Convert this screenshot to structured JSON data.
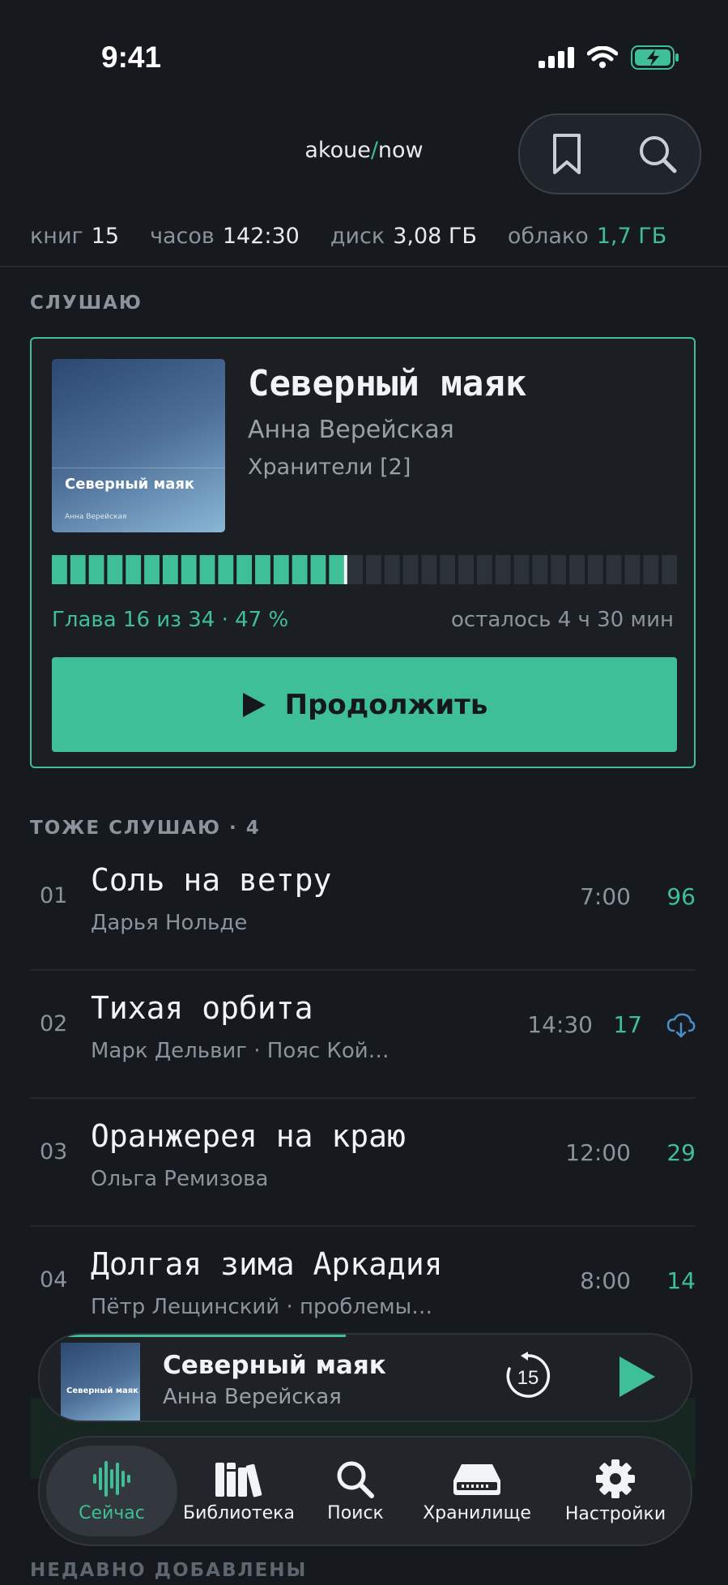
{
  "status_bar": {
    "time": "9:41"
  },
  "header": {
    "brand_left": "akoue",
    "brand_slash": "/",
    "brand_right": "now",
    "bookmark_icon": "bookmark-icon",
    "search_icon": "search-icon"
  },
  "stats": [
    {
      "key": "книг",
      "value": "15"
    },
    {
      "key": "часов",
      "value": "142:30"
    },
    {
      "key": "диск",
      "value": "3,08 ГБ"
    },
    {
      "key": "облако",
      "value": "1,7 ГБ"
    }
  ],
  "listening": {
    "section_label": "СЛУШАЮ",
    "cover_title": "Северный маяк",
    "cover_author": "Анна Верейская",
    "title": "Северный маяк",
    "author": "Анна Верейская",
    "series": "Хранители [2]",
    "progress": 0.47,
    "chapter_text": "Глава 16 из 34 · 47 %",
    "remaining": "осталось 4 ч 30 мин",
    "continue_label": "Продолжить",
    "colors": {
      "accent": "#3fbf95"
    }
  },
  "also": {
    "section_label": "ТОЖЕ СЛУШАЮ · 4",
    "items": [
      {
        "num": "01",
        "title": "Соль на ветру",
        "sub": "Дарья Нольде",
        "duration": "7:00",
        "count": "96",
        "cloud": false
      },
      {
        "num": "02",
        "title": "Тихая орбита",
        "sub": "Марк Дельвиг · Пояс Кой…",
        "duration": "14:30",
        "count": "17",
        "cloud": true
      },
      {
        "num": "03",
        "title": "Оранжерея на краю",
        "sub": "Ольга Ремизова",
        "duration": "12:00",
        "count": "29",
        "cloud": false
      },
      {
        "num": "04",
        "title": "Долгая зима Аркадия",
        "sub": "Пётр Лещинский · проблемы…",
        "duration": "8:00",
        "count": "14",
        "cloud": false
      }
    ]
  },
  "recent_label": "НЕДАВНО ДОБАВЛЕНЫ",
  "mini_player": {
    "cover_title": "Северный маяк",
    "title": "Северный маяк",
    "author": "Анна Верейская",
    "skip_label": "15",
    "progress": 0.47
  },
  "tabs": [
    {
      "label": "Сейчас",
      "icon": "waveform-icon",
      "active": true
    },
    {
      "label": "Библиотека",
      "icon": "books-icon",
      "active": false
    },
    {
      "label": "Поиск",
      "icon": "search-icon",
      "active": false
    },
    {
      "label": "Хранилище",
      "icon": "storage-icon",
      "active": false
    },
    {
      "label": "Настройки",
      "icon": "gear-icon",
      "active": false
    }
  ]
}
